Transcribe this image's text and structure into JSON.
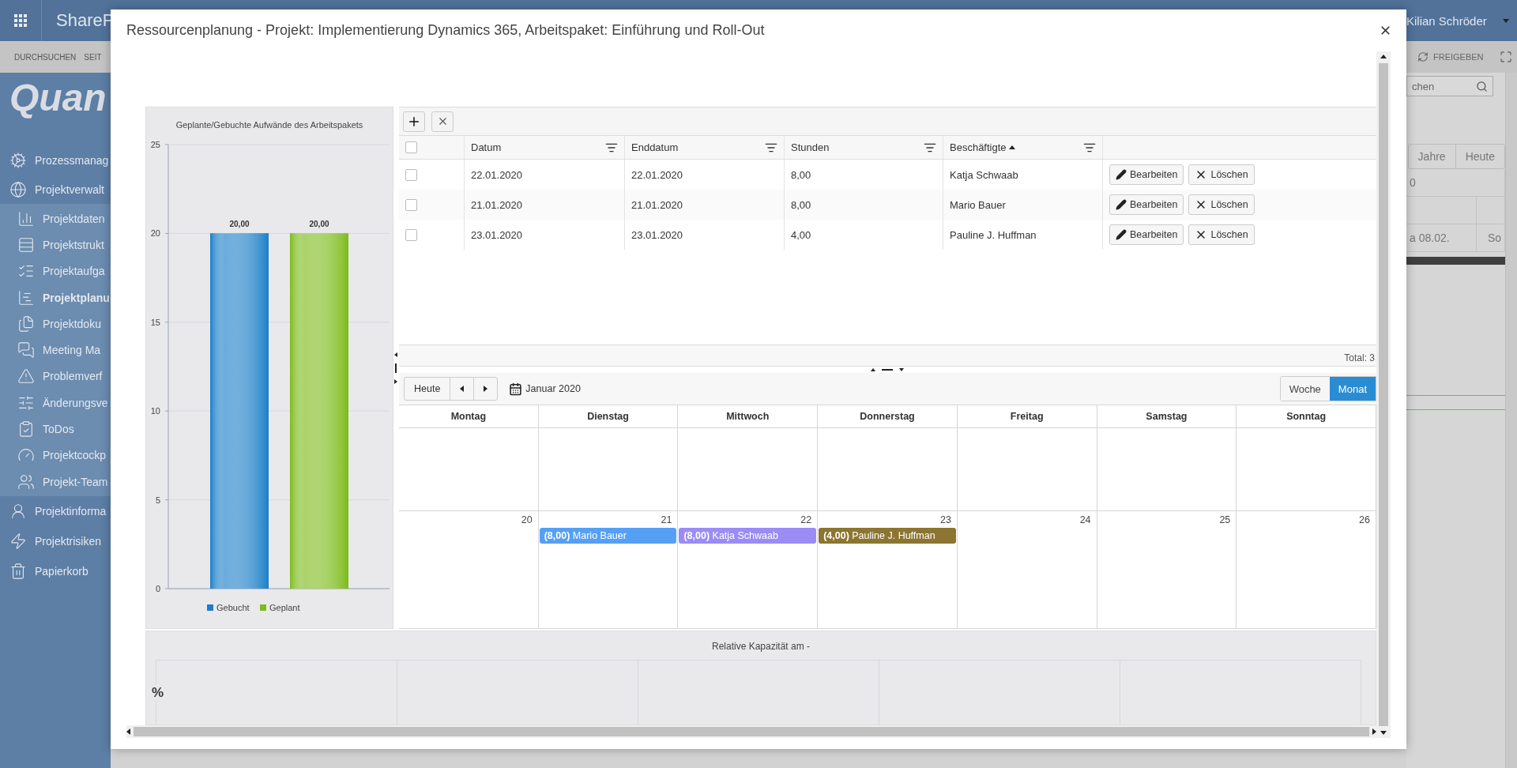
{
  "background_page": {
    "top_bar": {
      "app_name": "ShareP",
      "user_name": "Kilian Schröder"
    },
    "ribbon": {
      "tabs": [
        "DURCHSUCHEN",
        "SEIT"
      ],
      "share_label": "FREIGEBEN"
    },
    "logo": "Quan",
    "nav": [
      {
        "label": "Prozessmanag",
        "selected": false
      },
      {
        "label": "Projektverwalt",
        "selected": false,
        "expanded": true,
        "children": [
          {
            "label": "Projektdaten",
            "selected": false
          },
          {
            "label": "Projektstrukt",
            "selected": false
          },
          {
            "label": "Projektaufga",
            "selected": false
          },
          {
            "label": "Projektplanu",
            "selected": true
          },
          {
            "label": "Projektdoku",
            "selected": false
          },
          {
            "label": "Meeting Ma",
            "selected": false
          },
          {
            "label": "Problemverf",
            "selected": false
          },
          {
            "label": "Änderungsve",
            "selected": false
          },
          {
            "label": "ToDos",
            "selected": false
          },
          {
            "label": "Projektcockp",
            "selected": false
          },
          {
            "label": "Projekt-Team",
            "selected": false
          }
        ]
      },
      {
        "label": "Projektinforma",
        "selected": false
      },
      {
        "label": "Projektrisiken",
        "selected": false
      },
      {
        "label": "Papierkorb",
        "selected": false
      }
    ],
    "search": {
      "placeholder": "chen"
    },
    "timeline": {
      "buttons": [
        "Jahre",
        "Heute"
      ],
      "cells": [
        "0",
        "a 08.02.",
        "So"
      ]
    }
  },
  "dialog": {
    "title": "Ressourcenplanung - Projekt: Implementierung Dynamics 365, Arbeitspaket: Einführung und Roll-Out",
    "chart": {
      "chart_data": {
        "type": "bar",
        "title": "Geplante/Gebuchte Aufwände des Arbeitspakets",
        "series": [
          {
            "name": "Gebucht",
            "color": "#1a7ec8",
            "values": [
              20
            ]
          },
          {
            "name": "Geplant",
            "color": "#7cbb1a",
            "values": [
              20
            ]
          }
        ],
        "ylim": [
          0,
          25
        ],
        "yticks": [
          {
            "value": 0,
            "label": "0"
          },
          {
            "value": 5,
            "label": "5"
          },
          {
            "value": 10,
            "label": "10"
          },
          {
            "value": 15,
            "label": "15"
          },
          {
            "value": 20,
            "label": "20"
          },
          {
            "value": 25,
            "label": "25"
          }
        ],
        "value_labels": [
          "20,00",
          "20,00"
        ],
        "grid": true,
        "legend": true
      }
    },
    "table": {
      "header_checked": false,
      "columns": [
        {
          "label": "Datum",
          "sorted": false
        },
        {
          "label": "Enddatum",
          "sorted": false
        },
        {
          "label": "Stunden",
          "sorted": false
        },
        {
          "label": "Beschäftigte",
          "sorted": true
        }
      ],
      "rows": [
        {
          "checked": false,
          "cells": [
            "22.01.2020",
            "22.01.2020",
            "8,00",
            "Katja Schwaab"
          ],
          "actions": [
            {
              "kind": "edit",
              "label": "Bearbeiten"
            },
            {
              "kind": "delete",
              "label": "Löschen"
            }
          ]
        },
        {
          "checked": false,
          "cells": [
            "21.01.2020",
            "21.01.2020",
            "8,00",
            "Mario Bauer"
          ],
          "actions": [
            {
              "kind": "edit",
              "label": "Bearbeiten"
            },
            {
              "kind": "delete",
              "label": "Löschen"
            }
          ]
        },
        {
          "checked": false,
          "cells": [
            "23.01.2020",
            "23.01.2020",
            "4,00",
            "Pauline J. Huffman"
          ],
          "actions": [
            {
              "kind": "edit",
              "label": "Bearbeiten"
            },
            {
              "kind": "delete",
              "label": "Löschen"
            }
          ]
        }
      ],
      "total": "Total: 3"
    },
    "calendar": {
      "today_label": "Heute",
      "month_label": "Januar 2020",
      "views": [
        {
          "label": "Woche",
          "selected": false
        },
        {
          "label": "Monat",
          "selected": true
        }
      ],
      "weekdays": [
        "Montag",
        "Dienstag",
        "Mittwoch",
        "Donnerstag",
        "Freitag",
        "Samstag",
        "Sonntag"
      ],
      "weeks": [
        {
          "kind": "blank"
        },
        {
          "kind": "dated",
          "days": [
            {
              "number": "20"
            },
            {
              "number": "21",
              "events": [
                {
                  "text": "**(8,00)** Mario Bauer",
                  "color": "#55a0f5"
                }
              ]
            },
            {
              "number": "22",
              "events": [
                {
                  "text": "**(8,00)** Katja Schwaab",
                  "color": "#9b8cf5"
                }
              ]
            },
            {
              "number": "23",
              "events": [
                {
                  "text": "**(4,00)** Pauline J. Huffman",
                  "color": "#8b7530"
                }
              ]
            },
            {
              "number": "24"
            },
            {
              "number": "25"
            },
            {
              "number": "26"
            }
          ]
        }
      ]
    },
    "capacity_chart": {
      "title": "Relative Kapazität am -",
      "unit_label": "%"
    }
  }
}
